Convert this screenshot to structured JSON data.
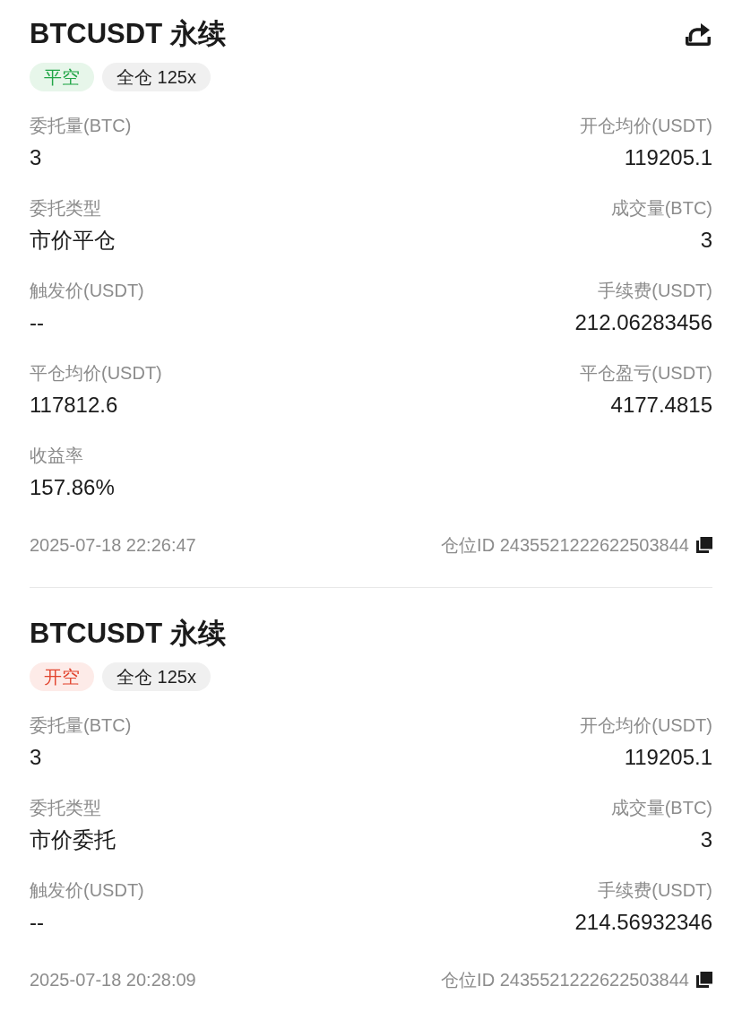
{
  "orders": [
    {
      "title": "BTCUSDT 永续",
      "share_button": true,
      "side": {
        "text": "平空",
        "kind": "close"
      },
      "margin": "全仓 125x",
      "rows": [
        {
          "left": {
            "label": "委托量(BTC)",
            "value": "3"
          },
          "right": {
            "label": "开仓均价(USDT)",
            "value": "119205.1"
          }
        },
        {
          "left": {
            "label": "委托类型",
            "value": "市价平仓"
          },
          "right": {
            "label": "成交量(BTC)",
            "value": "3"
          }
        },
        {
          "left": {
            "label": "触发价(USDT)",
            "value": "--"
          },
          "right": {
            "label": "手续费(USDT)",
            "value": "212.06283456"
          }
        },
        {
          "left": {
            "label": "平仓均价(USDT)",
            "value": "117812.6"
          },
          "right": {
            "label": "平仓盈亏(USDT)",
            "value": "4177.4815"
          }
        },
        {
          "left": {
            "label": "收益率",
            "value": "157.86%"
          }
        }
      ],
      "time": "2025-07-18 22:26:47",
      "position_id": "仓位ID 2435521222622503844"
    },
    {
      "title": "BTCUSDT 永续",
      "share_button": false,
      "side": {
        "text": "开空",
        "kind": "open"
      },
      "margin": "全仓 125x",
      "rows": [
        {
          "left": {
            "label": "委托量(BTC)",
            "value": "3"
          },
          "right": {
            "label": "开仓均价(USDT)",
            "value": "119205.1"
          }
        },
        {
          "left": {
            "label": "委托类型",
            "value": "市价委托"
          },
          "right": {
            "label": "成交量(BTC)",
            "value": "3"
          }
        },
        {
          "left": {
            "label": "触发价(USDT)",
            "value": "--"
          },
          "right": {
            "label": "手续费(USDT)",
            "value": "214.56932346"
          }
        }
      ],
      "time": "2025-07-18 20:28:09",
      "position_id": "仓位ID 2435521222622503844"
    }
  ]
}
